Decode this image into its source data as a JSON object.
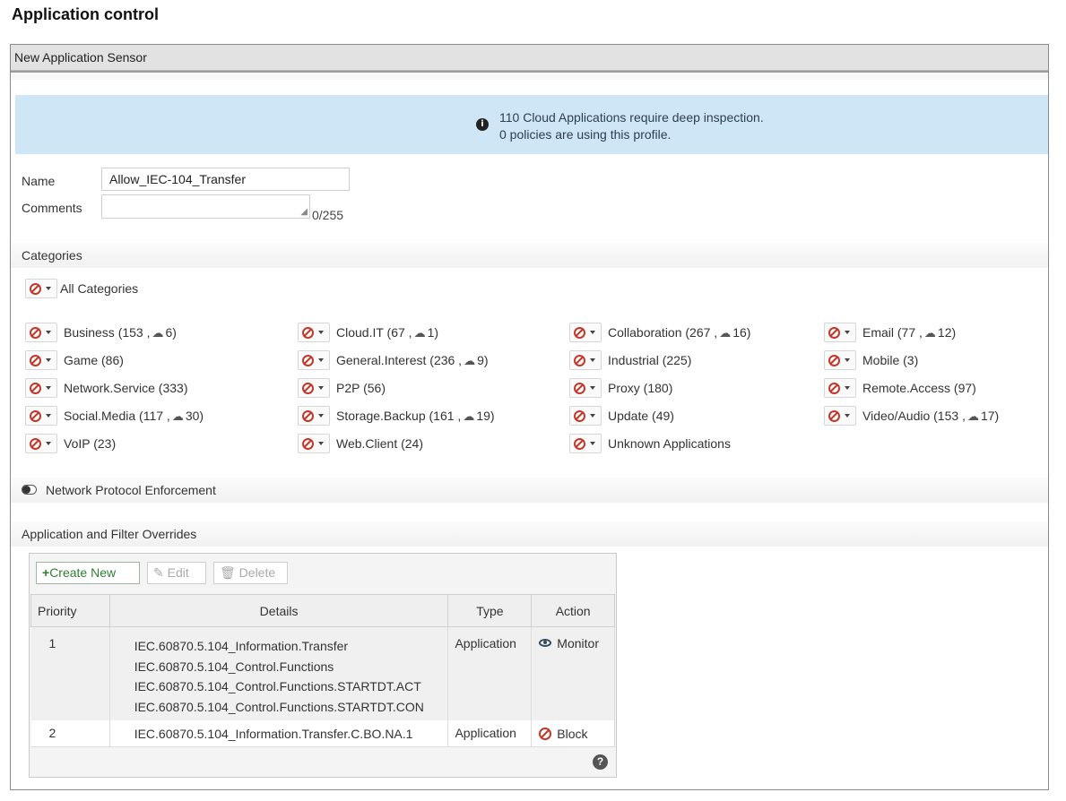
{
  "page": {
    "title": "Application control"
  },
  "panel": {
    "header": "New Application Sensor"
  },
  "banner": {
    "line1": "110 Cloud Applications require deep inspection.",
    "line2": "0 policies are using this profile."
  },
  "form": {
    "name_label": "Name",
    "name_value": "Allow_IEC-104_Transfer",
    "comments_label": "Comments",
    "comments_value": "",
    "comments_counter": "0/255"
  },
  "categories": {
    "section_label": "Categories",
    "all_label": "All Categories",
    "items": [
      {
        "name": "Business (153 ,",
        "cloud": "6)"
      },
      {
        "name": "Cloud.IT (67 ,",
        "cloud": "1)"
      },
      {
        "name": "Collaboration (267 ,",
        "cloud": "16)"
      },
      {
        "name": "Email (77 ,",
        "cloud": "12)"
      },
      {
        "name": "Game (86)",
        "cloud": ""
      },
      {
        "name": "General.Interest (236 ,",
        "cloud": "9)"
      },
      {
        "name": "Industrial (225)",
        "cloud": ""
      },
      {
        "name": "Mobile (3)",
        "cloud": ""
      },
      {
        "name": "Network.Service (333)",
        "cloud": ""
      },
      {
        "name": "P2P (56)",
        "cloud": ""
      },
      {
        "name": "Proxy (180)",
        "cloud": ""
      },
      {
        "name": "Remote.Access (97)",
        "cloud": ""
      },
      {
        "name": "Social.Media (117 ,",
        "cloud": "30)"
      },
      {
        "name": "Storage.Backup (161 ,",
        "cloud": "19)"
      },
      {
        "name": "Update (49)",
        "cloud": ""
      },
      {
        "name": "Video/Audio (153 ,",
        "cloud": "17)"
      },
      {
        "name": "VoIP (23)",
        "cloud": ""
      },
      {
        "name": "Web.Client (24)",
        "cloud": ""
      },
      {
        "name": "Unknown Applications",
        "cloud": ""
      }
    ]
  },
  "network_protocol": {
    "label": "Network Protocol Enforcement",
    "enabled": false
  },
  "overrides": {
    "section_label": "Application and Filter Overrides",
    "toolbar": {
      "create": "Create New",
      "edit": "Edit",
      "delete": "Delete"
    },
    "columns": [
      "Priority",
      "Details",
      "Type",
      "Action"
    ],
    "rows": [
      {
        "priority": "1",
        "details": [
          "IEC.60870.5.104_Information.Transfer",
          "IEC.60870.5.104_Control.Functions",
          "IEC.60870.5.104_Control.Functions.STARTDT.ACT",
          "IEC.60870.5.104_Control.Functions.STARTDT.CON"
        ],
        "type": "Application",
        "action": "Monitor"
      },
      {
        "priority": "2",
        "details": [
          "IEC.60870.5.104_Information.Transfer.C.BO.NA.1"
        ],
        "type": "Application",
        "action": "Block"
      }
    ]
  }
}
